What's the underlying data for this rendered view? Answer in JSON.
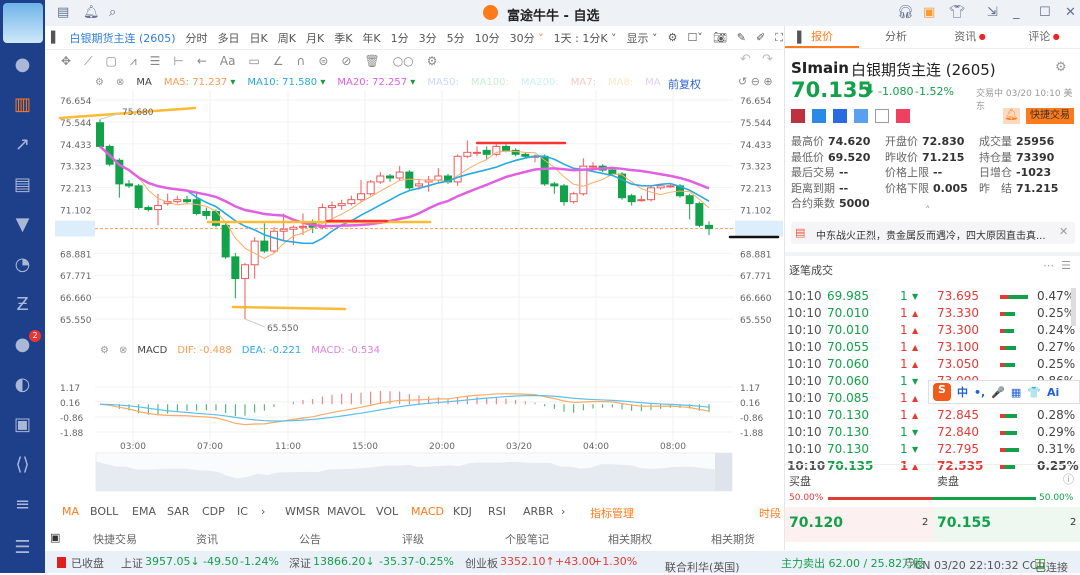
{
  "app": {
    "title": "富途牛牛 - 自选"
  },
  "sidebar": {
    "icons": [
      "user-icon",
      "chart-icon",
      "trend-icon",
      "report-icon",
      "filter-icon",
      "pie-icon",
      "exchange-icon",
      "chat-icon",
      "moon-icon",
      "game-icon",
      "code-icon",
      "document-icon",
      "menu-icon"
    ],
    "chat_badge": "2"
  },
  "toolbar": {
    "symbol": "白银期货主连 (2605)",
    "periods": [
      "分时",
      "多日",
      "日K",
      "周K",
      "月K",
      "季K",
      "年K",
      "1分",
      "3分",
      "5分",
      "10分"
    ],
    "active_period": "30分",
    "range": "1天 : 1分K",
    "display": "显示"
  },
  "drawing_tools": [
    "✥",
    "⟋",
    "▢",
    "⩘",
    "☰",
    "⊢",
    "←",
    "Aa",
    "▭",
    "∠",
    "∩",
    "⊜",
    "⊘",
    "🗑",
    "○○",
    "⚙"
  ],
  "ma_legend": {
    "label": "MA",
    "ma5": "MA5: 71.237",
    "ma10": "MA10: 71.580",
    "ma20": "MA20: 72.257",
    "ma50": "MA50:",
    "ma100": "MA100:",
    "ma200": "MA200:",
    "ma7": "MA7:",
    "ma8": "MA8:",
    "ma9": "MA",
    "adjust": "前复权"
  },
  "colors": {
    "up": "#f05a5a",
    "down": "#11a24a",
    "ma5": "#ffaa66",
    "ma10": "#29a9e0",
    "ma20": "#e060e0",
    "accent": "#ff7a1a"
  },
  "price_axis": [
    "76.654",
    "75.544",
    "74.433",
    "73.323",
    "72.213",
    "71.102",
    "70.135",
    "68.881",
    "67.771",
    "66.660",
    "65.550"
  ],
  "price_annotations": {
    "high": "75.680",
    "low": "65.550",
    "current": "70.135"
  },
  "macd_legend": {
    "label": "MACD",
    "dif": "DIF: -0.488",
    "dea": "DEA: -0.221",
    "macd": "MACD: -0.534"
  },
  "macd_axis": [
    "1.17",
    "0.16",
    "-0.86",
    "-1.88"
  ],
  "time_axis": [
    "03:00",
    "07:00",
    "11:00",
    "15:00",
    "20:00",
    "03/20",
    "04:00",
    "08:00"
  ],
  "chart_data": {
    "type": "candlestick",
    "ylim": [
      65.55,
      76.654
    ],
    "macd_ylim": [
      -1.88,
      1.17
    ],
    "candles": [
      [
        75.5,
        74.3,
        75.68,
        74.2
      ],
      [
        74.3,
        73.4,
        74.4,
        73.3
      ],
      [
        73.6,
        72.4,
        73.7,
        71.7
      ],
      [
        72.4,
        72.3,
        72.6,
        72.2
      ],
      [
        72.3,
        71.2,
        72.4,
        71.1
      ],
      [
        71.2,
        71.1,
        71.3,
        71.0
      ],
      [
        71.1,
        71.3,
        71.9,
        70.3
      ],
      [
        71.4,
        71.5,
        71.9,
        71.3
      ],
      [
        71.5,
        71.6,
        71.8,
        71.4
      ],
      [
        71.6,
        71.5,
        71.8,
        71.4
      ],
      [
        71.6,
        70.9,
        72.0,
        70.8
      ],
      [
        71.0,
        70.8,
        71.2,
        70.6
      ],
      [
        71.0,
        70.3,
        71.1,
        70.2
      ],
      [
        70.3,
        68.7,
        70.4,
        68.6
      ],
      [
        68.7,
        67.6,
        68.9,
        66.6
      ],
      [
        67.6,
        68.3,
        68.4,
        65.55
      ],
      [
        68.3,
        69.5,
        69.7,
        67.6
      ],
      [
        69.5,
        69.0,
        70.4,
        68.9
      ],
      [
        69.0,
        70.0,
        70.2,
        68.9
      ],
      [
        70.0,
        70.1,
        70.9,
        69.5
      ],
      [
        70.1,
        70.2,
        70.3,
        69.3
      ],
      [
        70.2,
        70.25,
        70.9,
        69.8
      ],
      [
        70.4,
        70.2,
        70.6,
        69.9
      ],
      [
        70.2,
        71.2,
        71.4,
        70.1
      ],
      [
        71.2,
        71.3,
        71.5,
        70.5
      ],
      [
        71.3,
        71.4,
        71.6,
        71.1
      ],
      [
        71.4,
        71.6,
        71.8,
        71.3
      ],
      [
        71.6,
        71.9,
        72.6,
        71.5
      ],
      [
        71.9,
        72.5,
        72.6,
        71.8
      ],
      [
        72.5,
        72.8,
        73.0,
        72.4
      ],
      [
        72.8,
        72.7,
        72.9,
        72.5
      ],
      [
        72.7,
        73.0,
        73.3,
        72.6
      ],
      [
        73.0,
        72.2,
        73.1,
        72.1
      ],
      [
        72.3,
        72.4,
        72.6,
        72.1
      ],
      [
        72.5,
        72.6,
        72.8,
        72.0
      ],
      [
        72.6,
        72.8,
        73.2,
        72.5
      ],
      [
        72.8,
        72.5,
        72.9,
        72.4
      ],
      [
        72.5,
        73.8,
        73.9,
        72.3
      ],
      [
        73.8,
        74.0,
        74.6,
        73.7
      ],
      [
        74.0,
        74.0,
        74.3,
        73.8
      ],
      [
        74.1,
        73.9,
        74.3,
        73.6
      ],
      [
        73.9,
        74.3,
        74.4,
        73.8
      ],
      [
        74.3,
        74.1,
        74.4,
        74.0
      ],
      [
        74.1,
        73.9,
        74.2,
        73.8
      ],
      [
        73.9,
        73.8,
        74.0,
        73.7
      ],
      [
        73.8,
        73.8,
        73.9,
        73.5
      ],
      [
        73.8,
        72.4,
        73.9,
        72.3
      ],
      [
        72.4,
        72.3,
        72.5,
        71.9
      ],
      [
        72.3,
        71.5,
        72.4,
        71.3
      ],
      [
        71.5,
        71.9,
        72.0,
        71.4
      ],
      [
        71.9,
        73.3,
        73.7,
        71.8
      ],
      [
        73.3,
        73.3,
        73.5,
        73.1
      ],
      [
        73.3,
        73.1,
        73.4,
        73.0
      ],
      [
        73.1,
        72.9,
        73.2,
        72.8
      ],
      [
        72.9,
        71.7,
        73.0,
        71.6
      ],
      [
        71.8,
        71.5,
        71.9,
        71.3
      ],
      [
        71.6,
        71.6,
        71.8,
        71.5
      ],
      [
        71.6,
        72.2,
        72.3,
        71.5
      ],
      [
        72.2,
        72.3,
        72.4,
        72.1
      ],
      [
        72.3,
        72.3,
        72.4,
        72.2
      ],
      [
        72.3,
        71.8,
        72.4,
        71.7
      ],
      [
        71.8,
        71.4,
        71.9,
        70.6
      ],
      [
        71.4,
        70.3,
        71.5,
        70.2
      ],
      [
        70.3,
        70.135,
        70.5,
        69.8
      ]
    ]
  },
  "indicators": {
    "main": [
      "MA",
      "BOLL",
      "EMA",
      "SAR",
      "CDP",
      "IC"
    ],
    "sub": [
      "WMSR",
      "MAVOL",
      "VOL",
      "MACD",
      "KDJ",
      "RSI",
      "ARBR"
    ],
    "manage": "指标管理",
    "period": "时段"
  },
  "bottom_tabs": [
    "快捷交易",
    "资讯",
    "公告",
    "评级",
    "个股笔记",
    "相关期权",
    "相关期货"
  ],
  "status": {
    "market": "已收盘",
    "sh_label": "上证",
    "sh_val": "3957.05↓",
    "sh_chg": "-49.50",
    "sh_pct": "-1.24%",
    "sz_label": "深证",
    "sz_val": "13866.20↓",
    "sz_chg": "-35.37",
    "sz_pct": "-0.25%",
    "cy_label": "创业板",
    "cy_val": "3352.10↑",
    "cy_chg": "+43.00",
    "cy_pct": "+1.30%",
    "news": "联合利华(英国)",
    "flow": "主力卖出 62.00 / 25.82万股",
    "clock": "CN 03/20 22:10:32 CCT",
    "conn": "已连接"
  },
  "right": {
    "tabs": [
      "报价",
      "分析",
      "资讯",
      "评论"
    ],
    "code": "SImain",
    "name": "白银期货主连 (2605)",
    "price": "70.135",
    "change": "-1.080",
    "pct": "-1.52%",
    "state": "交易中 03/20 10:10 美东",
    "quick_trade": "快捷交易",
    "stats": [
      [
        "最高价",
        "74.620",
        "red"
      ],
      [
        "开盘价",
        "72.830",
        "red"
      ],
      [
        "成交量",
        "25956",
        ""
      ],
      [
        "最低价",
        "69.520",
        "green"
      ],
      [
        "昨收价",
        "71.215",
        ""
      ],
      [
        "持仓量",
        "73390",
        ""
      ],
      [
        "最后交易",
        "--",
        ""
      ],
      [
        "价格上限",
        "--",
        ""
      ],
      [
        "日增仓",
        "-1023",
        ""
      ],
      [
        "距离到期",
        "--",
        ""
      ],
      [
        "价格下限",
        "0.005",
        "green"
      ],
      [
        "昨　结",
        "71.215",
        ""
      ],
      [
        "合约乘数",
        "5000",
        ""
      ]
    ],
    "news": "中东战火正烈，贵金属反而遇冷，四大原因直击真...",
    "trades_title": "逐笔成交",
    "trades": [
      [
        "10:10",
        "69.985",
        "1",
        "down",
        "73.695",
        "0.47%"
      ],
      [
        "10:10",
        "70.010",
        "1",
        "up",
        "73.330",
        "0.25%"
      ],
      [
        "10:10",
        "70.010",
        "1",
        "up",
        "73.300",
        "0.24%"
      ],
      [
        "10:10",
        "70.055",
        "1",
        "up",
        "73.100",
        "0.27%"
      ],
      [
        "10:10",
        "70.060",
        "1",
        "up",
        "73.050",
        "0.25%"
      ],
      [
        "10:10",
        "70.060",
        "1",
        "down",
        "73.000",
        "0.86%"
      ],
      [
        "10:10",
        "70.085",
        "1",
        "up",
        "72.845",
        "0.28%"
      ],
      [
        "10:10",
        "70.130",
        "1",
        "up",
        "72.845",
        "0.28%"
      ],
      [
        "10:10",
        "70.130",
        "1",
        "down",
        "72.840",
        "0.29%"
      ],
      [
        "10:10",
        "70.130",
        "1",
        "down",
        "72.795",
        "0.31%"
      ],
      [
        "10:10",
        "70.135",
        "1",
        "up",
        "72.535",
        "0.25%"
      ]
    ],
    "bid_label": "买盘",
    "ask_label": "卖盘",
    "bid_pct": "50.00%",
    "ask_pct": "50.00%",
    "bid_ratio": 0.5,
    "bid": "70.120",
    "bid_qty": "2",
    "ask": "70.155",
    "ask_qty": "2"
  },
  "ime": {
    "items": [
      "中",
      "•,",
      "🎤",
      "▦",
      "👕",
      "Ai"
    ]
  }
}
